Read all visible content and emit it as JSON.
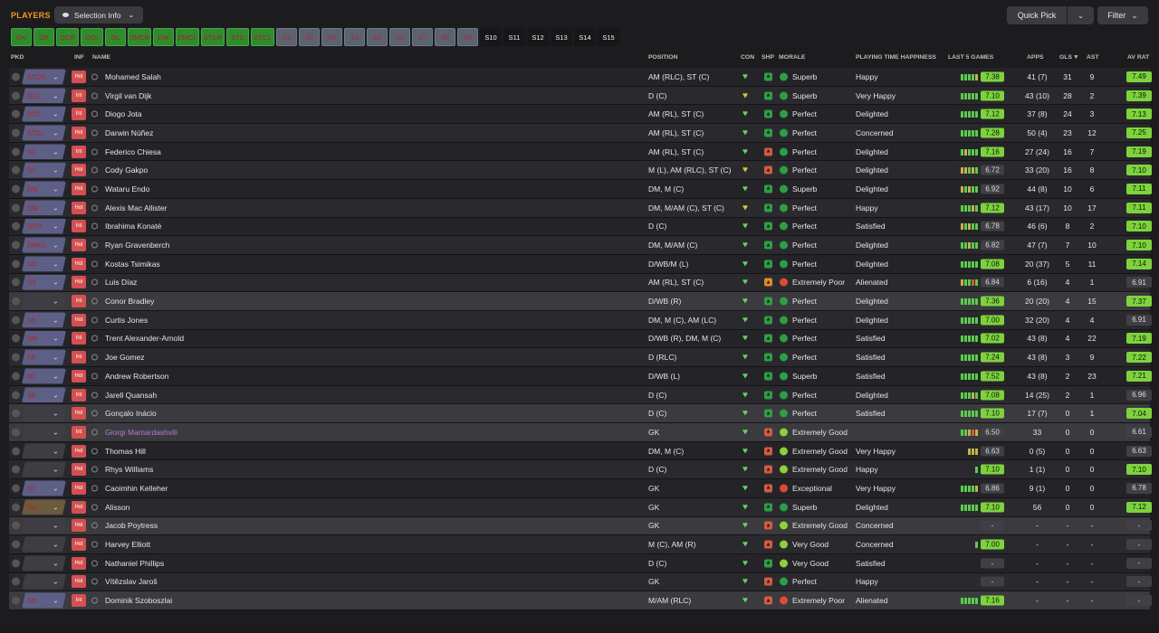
{
  "header": {
    "title": "PLAYERS",
    "selection_info_label": "Selection Info",
    "quick_pick_label": "Quick Pick",
    "filter_label": "Filter"
  },
  "position_tabs": [
    {
      "label": "GK",
      "state": "green"
    },
    {
      "label": "DR",
      "state": "green"
    },
    {
      "label": "DCR",
      "state": "green"
    },
    {
      "label": "DCL",
      "state": "green"
    },
    {
      "label": "DL",
      "state": "green"
    },
    {
      "label": "DMCR",
      "state": "green"
    },
    {
      "label": "DM",
      "state": "green"
    },
    {
      "label": "DMCL",
      "state": "green"
    },
    {
      "label": "STCR",
      "state": "green"
    },
    {
      "label": "STC",
      "state": "green"
    },
    {
      "label": "STCL",
      "state": "green"
    },
    {
      "label": "S1",
      "state": "grey"
    },
    {
      "label": "S2",
      "state": "grey"
    },
    {
      "label": "S3",
      "state": "grey"
    },
    {
      "label": "S4",
      "state": "grey"
    },
    {
      "label": "S5",
      "state": "grey"
    },
    {
      "label": "S6",
      "state": "grey"
    },
    {
      "label": "S7",
      "state": "grey"
    },
    {
      "label": "S8",
      "state": "grey"
    },
    {
      "label": "S9",
      "state": "grey"
    },
    {
      "label": "S10",
      "state": "dark"
    },
    {
      "label": "S11",
      "state": "dark"
    },
    {
      "label": "S12",
      "state": "dark"
    },
    {
      "label": "S13",
      "state": "dark"
    },
    {
      "label": "S14",
      "state": "dark"
    },
    {
      "label": "S15",
      "state": "dark"
    }
  ],
  "columns": {
    "pkd": "PKD",
    "inf": "INF",
    "name": "NAME",
    "position": "POSITION",
    "con": "CON",
    "shp": "SHP",
    "morale": "MORALE",
    "pth": "PLAYING TIME HAPPINESS",
    "last5": "LAST 5 GAMES",
    "apps": "APPS",
    "gls": "GLS",
    "ast": "AST",
    "avrat": "AV RAT"
  },
  "players": [
    {
      "pkd": "STCR",
      "inf": "Hol",
      "name": "Mohamed Salah",
      "position": "AM (RLC), ST (C)",
      "shp": "green",
      "morale": "Superb",
      "mor": "green",
      "pth": "Happy",
      "last5": [
        "g",
        "g",
        "g",
        "g",
        "y"
      ],
      "rating5": "7.38",
      "r5": "g",
      "apps": "41 (7)",
      "gls": "31",
      "ast": "9",
      "av": "7.49",
      "avc": "g",
      "pkdcolor": "purple"
    },
    {
      "pkd": "DCL",
      "inf": "Int",
      "name": "Virgil van Dijk",
      "position": "D (C)",
      "shp": "green",
      "morale": "Superb",
      "mor": "green",
      "pth": "Very Happy",
      "last5": [
        "g",
        "g",
        "g",
        "g",
        "g"
      ],
      "rating5": "7.10",
      "r5": "g",
      "apps": "43 (10)",
      "gls": "28",
      "ast": "2",
      "av": "7.39",
      "avc": "g",
      "pkdcolor": "purple",
      "conc": "yellow"
    },
    {
      "pkd": "STC",
      "inf": "Int",
      "name": "Diogo Jota",
      "position": "AM (RL), ST (C)",
      "shp": "green",
      "morale": "Perfect",
      "mor": "green",
      "pth": "Delighted",
      "last5": [
        "g",
        "g",
        "g",
        "g",
        "g"
      ],
      "rating5": "7.12",
      "r5": "g",
      "apps": "37 (8)",
      "gls": "24",
      "ast": "3",
      "av": "7.13",
      "avc": "g",
      "pkdcolor": "purple"
    },
    {
      "pkd": "STCL",
      "inf": "Hol",
      "name": "Darwin Núñez",
      "position": "AM (RL), ST (C)",
      "shp": "green",
      "morale": "Perfect",
      "mor": "green",
      "pth": "Concerned",
      "last5": [
        "g",
        "g",
        "g",
        "g",
        "g"
      ],
      "rating5": "7.28",
      "r5": "g",
      "apps": "50 (4)",
      "gls": "23",
      "ast": "12",
      "av": "7.25",
      "avc": "g",
      "pkdcolor": "purple"
    },
    {
      "pkd": "S1",
      "inf": "Int",
      "name": "Federico Chiesa",
      "position": "AM (RL), ST (C)",
      "shp": "red",
      "morale": "Perfect",
      "mor": "green",
      "pth": "Delighted",
      "last5": [
        "g",
        "y",
        "g",
        "g",
        "g"
      ],
      "rating5": "7.16",
      "r5": "g",
      "apps": "27 (24)",
      "gls": "16",
      "ast": "7",
      "av": "7.19",
      "avc": "g",
      "pkdcolor": "purple"
    },
    {
      "pkd": "S2",
      "inf": "Hol",
      "name": "Cody Gakpo",
      "position": "M (L), AM (RLC), ST (C)",
      "shp": "red",
      "morale": "Perfect",
      "mor": "green",
      "pth": "Delighted",
      "last5": [
        "y",
        "y",
        "g",
        "y",
        "g"
      ],
      "rating5": "6.72",
      "r5": "n",
      "apps": "33 (20)",
      "gls": "16",
      "ast": "8",
      "av": "7.10",
      "avc": "g",
      "pkdcolor": "purple",
      "conc": "yellow"
    },
    {
      "pkd": "DM",
      "inf": "Hol",
      "name": "Wataru Endo",
      "position": "DM, M (C)",
      "shp": "green",
      "morale": "Superb",
      "mor": "green",
      "pth": "Delighted",
      "last5": [
        "y",
        "g",
        "y",
        "g",
        "g"
      ],
      "rating5": "6.92",
      "r5": "n",
      "apps": "44 (8)",
      "gls": "10",
      "ast": "6",
      "av": "7.11",
      "avc": "g",
      "pkdcolor": "blue"
    },
    {
      "pkd": "DM...",
      "inf": "Hol",
      "name": "Alexis Mac Allister",
      "position": "DM, M/AM (C), ST (C)",
      "shp": "green",
      "morale": "Perfect",
      "mor": "green",
      "pth": "Happy",
      "last5": [
        "g",
        "g",
        "g",
        "y",
        "g"
      ],
      "rating5": "7.12",
      "r5": "g",
      "apps": "43 (17)",
      "gls": "10",
      "ast": "17",
      "av": "7.11",
      "avc": "g",
      "pkdcolor": "blue",
      "conc": "yellow"
    },
    {
      "pkd": "DCR",
      "inf": "Int",
      "name": "Ibrahima Konaté",
      "position": "D (C)",
      "shp": "green",
      "morale": "Perfect",
      "mor": "green",
      "pth": "Satisfied",
      "last5": [
        "y",
        "g",
        "y",
        "g",
        "g"
      ],
      "rating5": "6.78",
      "r5": "n",
      "apps": "46 (6)",
      "gls": "8",
      "ast": "2",
      "av": "7.10",
      "avc": "g",
      "pkdcolor": "blue"
    },
    {
      "pkd": "DMCL",
      "inf": "Hol",
      "name": "Ryan Gravenberch",
      "position": "DM, M/AM (C)",
      "shp": "green",
      "morale": "Perfect",
      "mor": "green",
      "pth": "Delighted",
      "last5": [
        "g",
        "g",
        "y",
        "g",
        "g"
      ],
      "rating5": "6.82",
      "r5": "n",
      "apps": "47 (7)",
      "gls": "7",
      "ast": "10",
      "av": "7.10",
      "avc": "g",
      "pkdcolor": "blue"
    },
    {
      "pkd": "S3",
      "inf": "Hol",
      "name": "Kostas Tsimikas",
      "position": "D/WB/M (L)",
      "shp": "green",
      "morale": "Perfect",
      "mor": "green",
      "pth": "Delighted",
      "last5": [
        "g",
        "g",
        "g",
        "g",
        "g"
      ],
      "rating5": "7.08",
      "r5": "g",
      "apps": "20 (37)",
      "gls": "5",
      "ast": "11",
      "av": "7.14",
      "avc": "g",
      "pkdcolor": "blue"
    },
    {
      "pkd": "S4",
      "inf": "Hol",
      "name": "Luis Díaz",
      "position": "AM (RL), ST (C)",
      "shp": "orange",
      "morale": "Extremely Poor",
      "mor": "bad",
      "pth": "Alienated",
      "last5": [
        "y",
        "g",
        "g",
        "r",
        "g"
      ],
      "rating5": "6.84",
      "r5": "n",
      "apps": "6 (16)",
      "gls": "4",
      "ast": "1",
      "av": "6.91",
      "avc": "n",
      "pkdcolor": "blue"
    },
    {
      "pkd": "-",
      "inf": "Int",
      "name": "Conor Bradley",
      "position": "D/WB (R)",
      "shp": "green",
      "morale": "Perfect",
      "mor": "green",
      "pth": "Delighted",
      "last5": [
        "g",
        "g",
        "g",
        "g",
        "g"
      ],
      "rating5": "7.36",
      "r5": "g",
      "apps": "20 (20)",
      "gls": "4",
      "ast": "15",
      "av": "7.37",
      "avc": "g",
      "pkdcolor": "none",
      "sel": true
    },
    {
      "pkd": "S5",
      "inf": "Hol",
      "name": "Curtis Jones",
      "position": "DM, M (C), AM (LC)",
      "shp": "green",
      "morale": "Perfect",
      "mor": "green",
      "pth": "Delighted",
      "last5": [
        "g",
        "g",
        "g",
        "g",
        "g"
      ],
      "rating5": "7.00",
      "r5": "g",
      "apps": "32 (20)",
      "gls": "4",
      "ast": "4",
      "av": "6.91",
      "avc": "n",
      "pkdcolor": "blue"
    },
    {
      "pkd": "DR",
      "inf": "Int",
      "name": "Trent Alexander-Arnold",
      "position": "D/WB (R), DM, M (C)",
      "shp": "green",
      "morale": "Perfect",
      "mor": "green",
      "pth": "Satisfied",
      "last5": [
        "g",
        "g",
        "g",
        "g",
        "g"
      ],
      "rating5": "7.02",
      "r5": "g",
      "apps": "43 (8)",
      "gls": "4",
      "ast": "22",
      "av": "7.19",
      "avc": "g",
      "pkdcolor": "blue"
    },
    {
      "pkd": "S6",
      "inf": "Int",
      "name": "Joe Gomez",
      "position": "D (RLC)",
      "shp": "green",
      "morale": "Perfect",
      "mor": "green",
      "pth": "Satisfied",
      "last5": [
        "g",
        "g",
        "g",
        "g",
        "g"
      ],
      "rating5": "7.24",
      "r5": "g",
      "apps": "43 (8)",
      "gls": "3",
      "ast": "9",
      "av": "7.22",
      "avc": "g",
      "pkdcolor": "blue"
    },
    {
      "pkd": "DL",
      "inf": "Hol",
      "name": "Andrew Robertson",
      "position": "D/WB (L)",
      "shp": "green",
      "morale": "Superb",
      "mor": "green",
      "pth": "Satisfied",
      "last5": [
        "g",
        "g",
        "g",
        "g",
        "g"
      ],
      "rating5": "7.52",
      "r5": "g",
      "apps": "43 (8)",
      "gls": "2",
      "ast": "23",
      "av": "7.21",
      "avc": "g",
      "pkdcolor": "blue"
    },
    {
      "pkd": "S8",
      "inf": "Int",
      "name": "Jarell Quansah",
      "position": "D (C)",
      "shp": "green",
      "morale": "Perfect",
      "mor": "green",
      "pth": "Delighted",
      "last5": [
        "g",
        "g",
        "g",
        "y",
        "g"
      ],
      "rating5": "7.08",
      "r5": "g",
      "apps": "14 (25)",
      "gls": "2",
      "ast": "1",
      "av": "6.96",
      "avc": "n",
      "pkdcolor": "blue"
    },
    {
      "pkd": "-",
      "inf": "Hol",
      "name": "Gonçalo Inácio",
      "position": "D (C)",
      "shp": "green",
      "morale": "Perfect",
      "mor": "green",
      "pth": "Satisfied",
      "last5": [
        "g",
        "g",
        "g",
        "g",
        "g"
      ],
      "rating5": "7.10",
      "r5": "g",
      "apps": "17 (7)",
      "gls": "0",
      "ast": "1",
      "av": "7.04",
      "avc": "g",
      "pkdcolor": "none",
      "sel": true
    },
    {
      "pkd": "-",
      "inf": "Int",
      "name": "Giorgi Mamardashvili",
      "position": "GK",
      "shp": "red",
      "morale": "Extremely Good",
      "mor": "good",
      "pth": "",
      "last5": [
        "g",
        "g",
        "y",
        "r",
        "y"
      ],
      "rating5": "6.50",
      "r5": "n",
      "apps": "33",
      "gls": "0",
      "ast": "0",
      "av": "6.61",
      "avc": "n",
      "pkdcolor": "none",
      "purple": true,
      "sel": true
    },
    {
      "pkd": "-",
      "inf": "Hol",
      "name": "Thomas Hill",
      "position": "DM, M (C)",
      "shp": "red",
      "morale": "Extremely Good",
      "mor": "good",
      "pth": "Very Happy",
      "last5": [
        "y",
        "y",
        "y"
      ],
      "rating5": "6.63",
      "r5": "n",
      "apps": "0 (5)",
      "gls": "0",
      "ast": "0",
      "av": "6.63",
      "avc": "n",
      "pkdcolor": "none"
    },
    {
      "pkd": "-",
      "inf": "Hol",
      "name": "Rhys Williams",
      "position": "D (C)",
      "shp": "red",
      "morale": "Extremely Good",
      "mor": "good",
      "pth": "Happy",
      "last5": [
        "g"
      ],
      "rating5": "7.10",
      "r5": "g",
      "apps": "1 (1)",
      "gls": "0",
      "ast": "0",
      "av": "7.10",
      "avc": "g",
      "pkdcolor": "none"
    },
    {
      "pkd": "S7",
      "inf": "Hol",
      "name": "Caoimhin Kelleher",
      "position": "GK",
      "shp": "red",
      "morale": "Exceptional",
      "mor": "bad",
      "pth": "Very Happy",
      "last5": [
        "g",
        "g",
        "g",
        "g",
        "y"
      ],
      "rating5": "6.86",
      "r5": "n",
      "apps": "9 (1)",
      "gls": "0",
      "ast": "0",
      "av": "6.78",
      "avc": "n",
      "pkdcolor": "blue"
    },
    {
      "pkd": "GK",
      "inf": "Hol",
      "name": "Alisson",
      "position": "GK",
      "shp": "green",
      "morale": "Superb",
      "mor": "green",
      "pth": "Delighted",
      "last5": [
        "g",
        "g",
        "g",
        "g",
        "g"
      ],
      "rating5": "7.10",
      "r5": "g",
      "apps": "56",
      "gls": "0",
      "ast": "0",
      "av": "7.12",
      "avc": "g",
      "pkdcolor": "gk"
    },
    {
      "pkd": "-",
      "inf": "Hol",
      "name": "Jacob Poytress",
      "position": "GK",
      "shp": "red",
      "morale": "Extremely Good",
      "mor": "good",
      "pth": "Concerned",
      "last5": [],
      "rating5": "-",
      "r5": "n",
      "apps": "-",
      "gls": "-",
      "ast": "-",
      "av": "-",
      "avc": "n",
      "pkdcolor": "none",
      "sel": true
    },
    {
      "pkd": "-",
      "inf": "Hol",
      "name": "Harvey Elliott",
      "position": "M (C), AM (R)",
      "shp": "red",
      "morale": "Very Good",
      "mor": "good",
      "pth": "Concerned",
      "last5": [
        "g"
      ],
      "rating5": "7.00",
      "r5": "g",
      "apps": "-",
      "gls": "-",
      "ast": "-",
      "av": "-",
      "avc": "n",
      "pkdcolor": "none"
    },
    {
      "pkd": "-",
      "inf": "Hol",
      "name": "Nathaniel Phillips",
      "position": "D (C)",
      "shp": "green",
      "morale": "Very Good",
      "mor": "good",
      "pth": "Satisfied",
      "last5": [],
      "rating5": "-",
      "r5": "n",
      "apps": "-",
      "gls": "-",
      "ast": "-",
      "av": "-",
      "avc": "n",
      "pkdcolor": "none"
    },
    {
      "pkd": "-",
      "inf": "Hol",
      "name": "Vítězslav Jaroš",
      "position": "GK",
      "shp": "red",
      "morale": "Perfect",
      "mor": "green",
      "pth": "Happy",
      "last5": [],
      "rating5": "-",
      "r5": "n",
      "apps": "-",
      "gls": "-",
      "ast": "-",
      "av": "-",
      "avc": "n",
      "pkdcolor": "none"
    },
    {
      "pkd": "S9",
      "inf": "Int",
      "name": "Dominik Szoboszlai",
      "position": "M/AM (RLC)",
      "shp": "red",
      "morale": "Extremely Poor",
      "mor": "bad",
      "pth": "Alienated",
      "last5": [
        "g",
        "g",
        "g",
        "g",
        "g"
      ],
      "rating5": "7.16",
      "r5": "g",
      "apps": "-",
      "gls": "-",
      "ast": "-",
      "av": "-",
      "avc": "n",
      "pkdcolor": "blue",
      "sel": true
    }
  ]
}
